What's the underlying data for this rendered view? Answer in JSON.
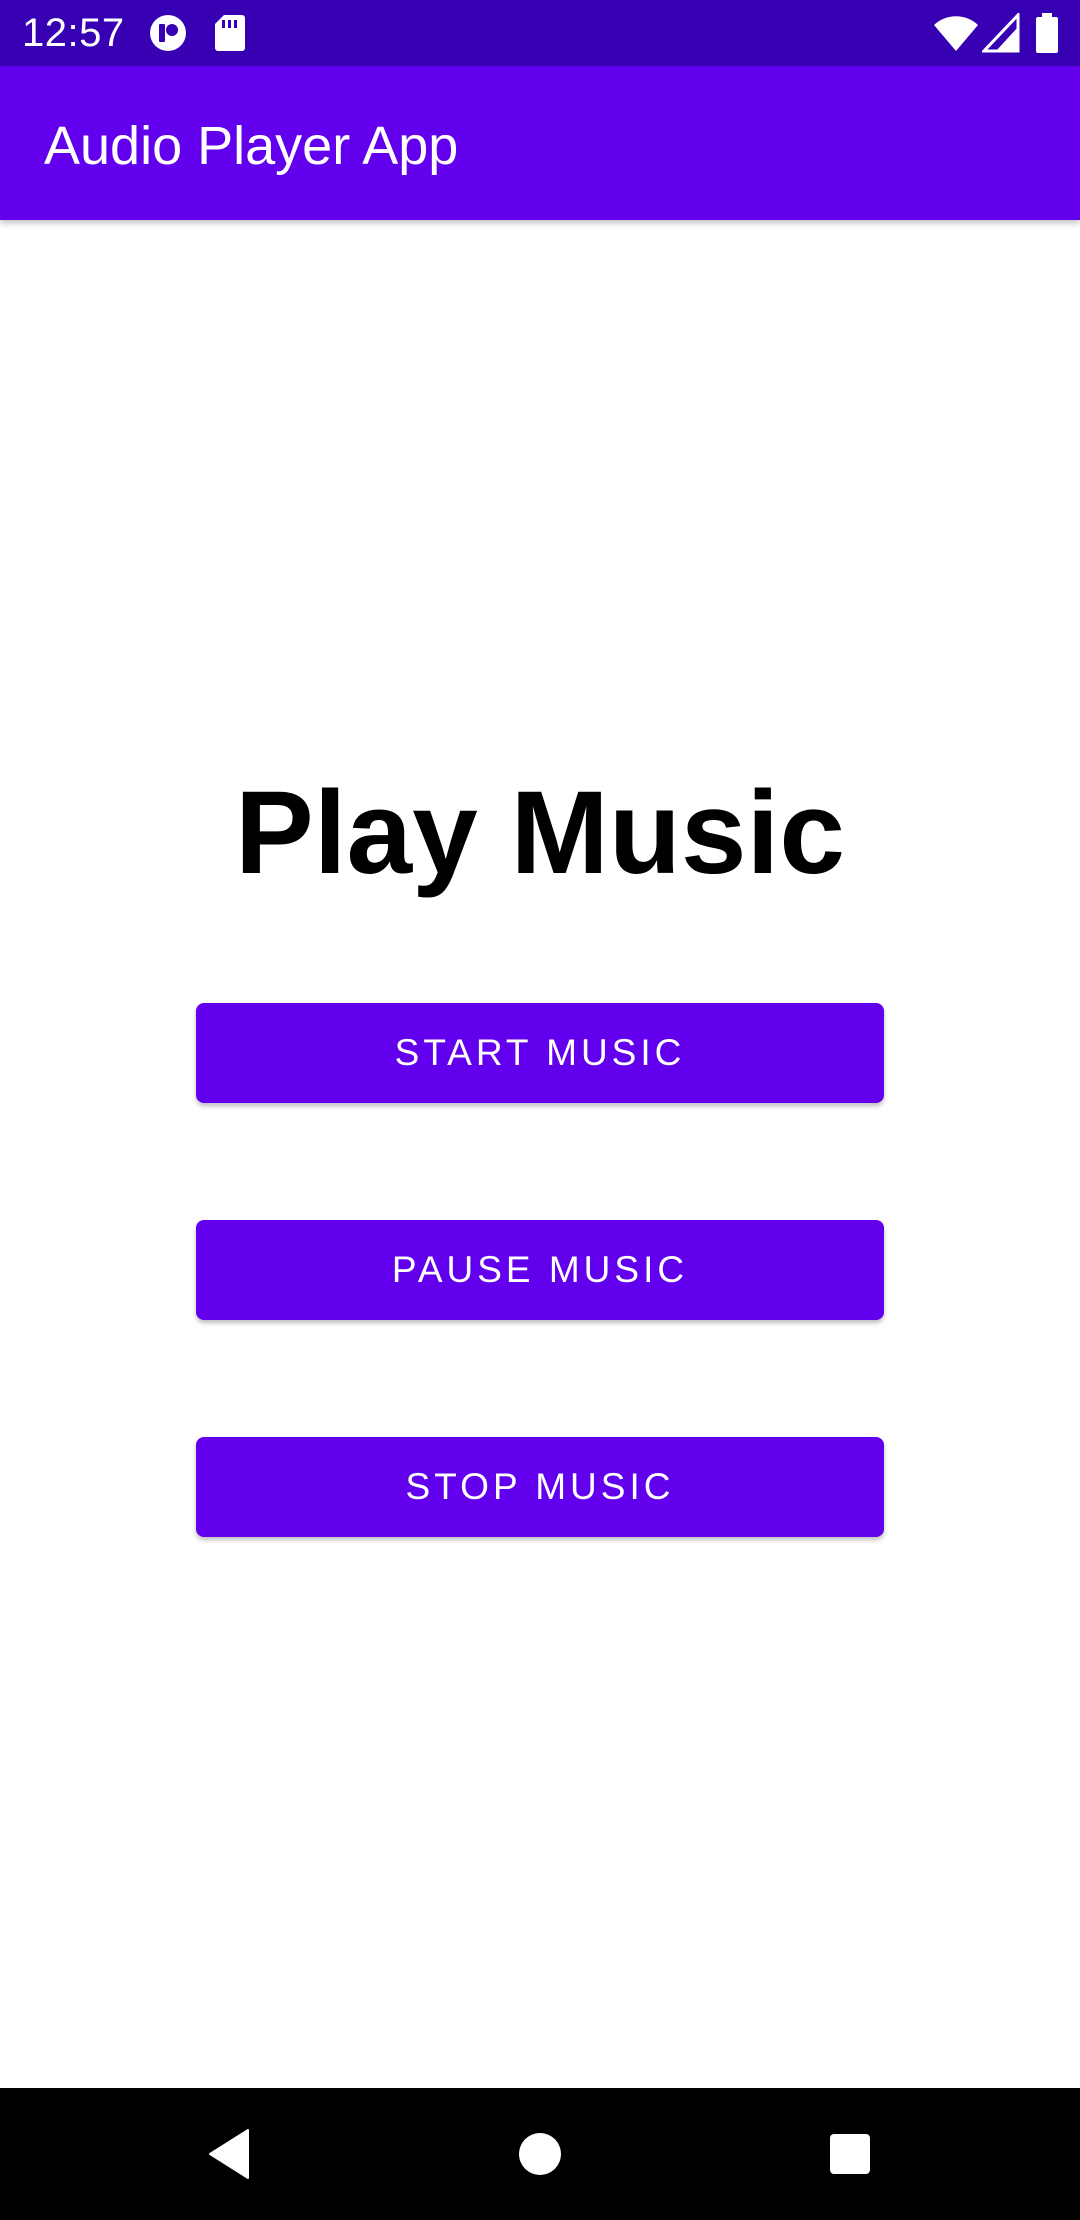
{
  "status_bar": {
    "time": "12:57",
    "icons": [
      "app-notification-icon",
      "sd-card-icon",
      "wifi-icon",
      "cell-signal-icon",
      "battery-icon"
    ]
  },
  "app_bar": {
    "title": "Audio Player App"
  },
  "main": {
    "heading": "Play Music",
    "buttons": {
      "start": "START MUSIC",
      "pause": "PAUSE MUSIC",
      "stop": "STOP MUSIC"
    }
  },
  "nav_bar": {
    "icons": [
      "back-icon",
      "home-icon",
      "recents-icon"
    ]
  },
  "colors": {
    "status_bar": "#3700b3",
    "primary": "#6200ee",
    "background": "#ffffff",
    "nav_bar": "#000000"
  }
}
